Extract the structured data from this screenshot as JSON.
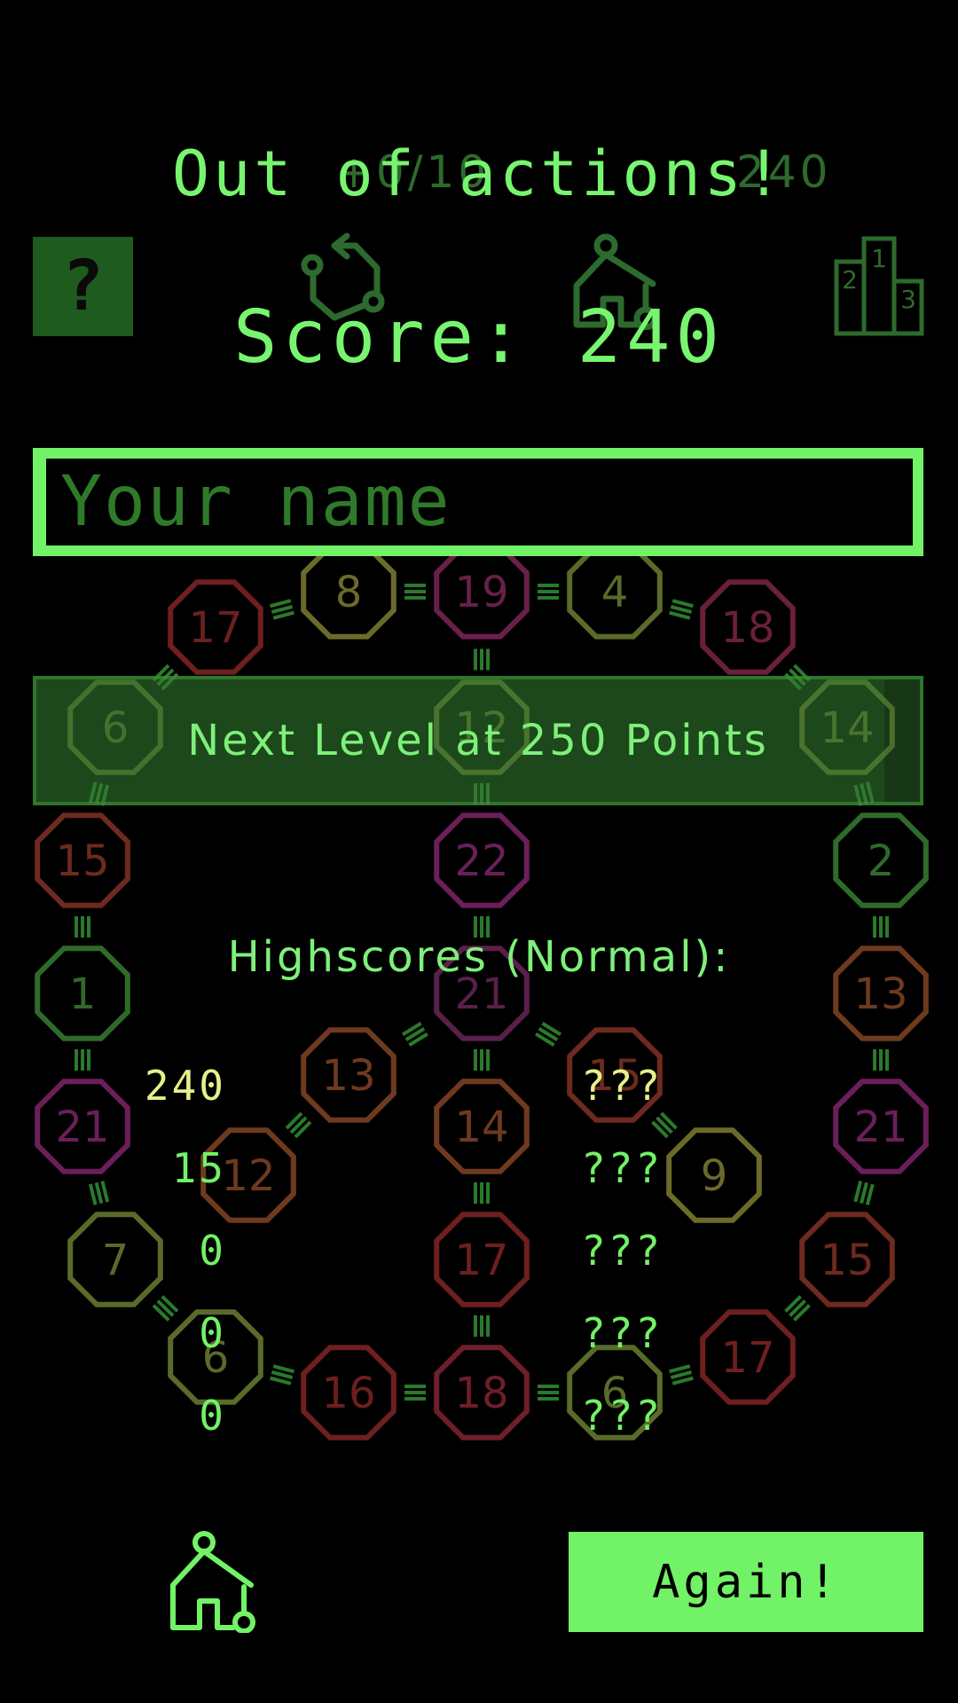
{
  "background_hud": {
    "progress_text": "+0/10",
    "score_small": "240"
  },
  "help_button": {
    "label": "?"
  },
  "popup": {
    "title": "Out of actions!",
    "score_text": "Score: 240",
    "name_input": {
      "placeholder": "Your name",
      "value": ""
    },
    "next_level": {
      "text": "Next Level at 250 Points",
      "progress": 0.96
    },
    "highscores_title": "Highscores (Normal):",
    "scores": [
      "240",
      "15",
      "0",
      "0",
      "0"
    ],
    "names": [
      "???",
      "???",
      "???",
      "???",
      "???"
    ],
    "again_label": "Again!"
  },
  "colors": {
    "accent": "#72f266",
    "dark_green": "#1f5a1f",
    "highlight_yellow": "#e6f08a"
  },
  "icons": [
    "help-icon",
    "restart-icon",
    "home-icon",
    "leaderboard-icon"
  ],
  "board_nodes": [
    {
      "label": "8",
      "color": "#6b6a2a"
    },
    {
      "label": "19",
      "color": "#6a1f4a"
    },
    {
      "label": "4",
      "color": "#5a6a2a"
    },
    {
      "label": "17",
      "color": "#6e1f1f"
    },
    {
      "label": "18",
      "color": "#6a1f3a"
    },
    {
      "label": "6",
      "color": "#5a6a2a"
    },
    {
      "label": "12",
      "color": "#6b6a2a"
    },
    {
      "label": "14",
      "color": "#6b6a2a"
    },
    {
      "label": "15",
      "color": "#6e2a1f"
    },
    {
      "label": "22",
      "color": "#6a1f5a"
    },
    {
      "label": "2",
      "color": "#2f6a2a"
    },
    {
      "label": "1",
      "color": "#2f6a2a"
    },
    {
      "label": "21",
      "color": "#5a1f4a"
    },
    {
      "label": "13",
      "color": "#6e3a1f"
    },
    {
      "label": "13",
      "color": "#6e3a1f"
    },
    {
      "label": "15",
      "color": "#6e2a1f"
    },
    {
      "label": "21",
      "color": "#6a1f5a"
    },
    {
      "label": "14",
      "color": "#6e3a1f"
    },
    {
      "label": "21",
      "color": "#6a1f5a"
    },
    {
      "label": "12",
      "color": "#6e3a1f"
    },
    {
      "label": "9",
      "color": "#6b6a2a"
    },
    {
      "label": "7",
      "color": "#5a6a2a"
    },
    {
      "label": "17",
      "color": "#6e1f1f"
    },
    {
      "label": "15",
      "color": "#6e2a1f"
    },
    {
      "label": "6",
      "color": "#5a6a2a"
    },
    {
      "label": "16",
      "color": "#6e1f1f"
    },
    {
      "label": "18",
      "color": "#6e1f2a"
    },
    {
      "label": "6",
      "color": "#5a6a2a"
    },
    {
      "label": "17",
      "color": "#6e1f1f"
    }
  ]
}
